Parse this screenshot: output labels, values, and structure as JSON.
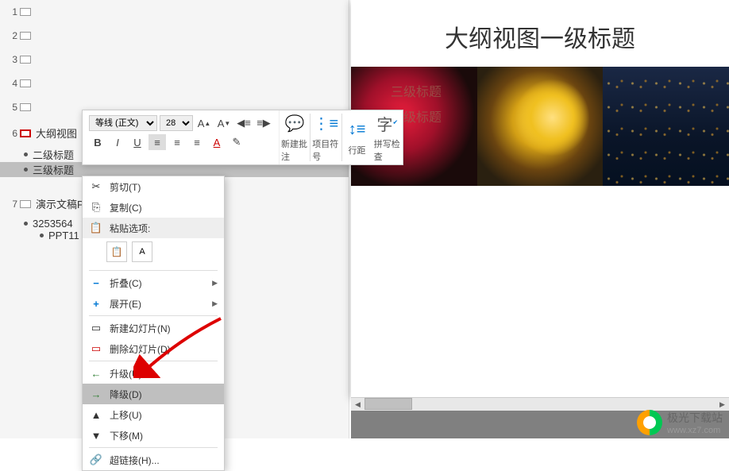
{
  "outline": {
    "items": [
      {
        "num": "1"
      },
      {
        "num": "2"
      },
      {
        "num": "3"
      },
      {
        "num": "4"
      },
      {
        "num": "5"
      },
      {
        "num": "6",
        "text": "大纲视图",
        "active": true
      },
      {
        "num": "7",
        "text": "演示文稿P"
      }
    ],
    "sub6": [
      {
        "text": "二级标题"
      },
      {
        "text": "三级标题",
        "selected": true
      }
    ],
    "sub7": [
      {
        "text": "3253564"
      },
      {
        "text": "PPT11",
        "nested": true
      }
    ]
  },
  "mini_toolbar": {
    "font_name": "等线 (正文)",
    "font_size": "28",
    "bold": "B",
    "italic": "I",
    "underline": "U",
    "new_comment": "新建批注",
    "bullets": "项目符号",
    "spacing": "行距",
    "spellcheck": "拼写检查"
  },
  "context_menu": {
    "cut": "剪切(T)",
    "copy": "复制(C)",
    "paste_header": "粘贴选项:",
    "collapse": "折叠(C)",
    "expand": "展开(E)",
    "new_slide": "新建幻灯片(N)",
    "delete_slide": "删除幻灯片(D)",
    "promote": "升级(U)",
    "demote": "降级(D)",
    "move_up": "上移(U)",
    "move_down": "下移(M)",
    "hyperlink": "超链接(H)..."
  },
  "slide": {
    "title": "大纲视图一级标题",
    "sub1": "三级标题",
    "sub2": "三级标题"
  },
  "watermark": {
    "name": "极光下载站",
    "url": "www.xz7.com"
  }
}
